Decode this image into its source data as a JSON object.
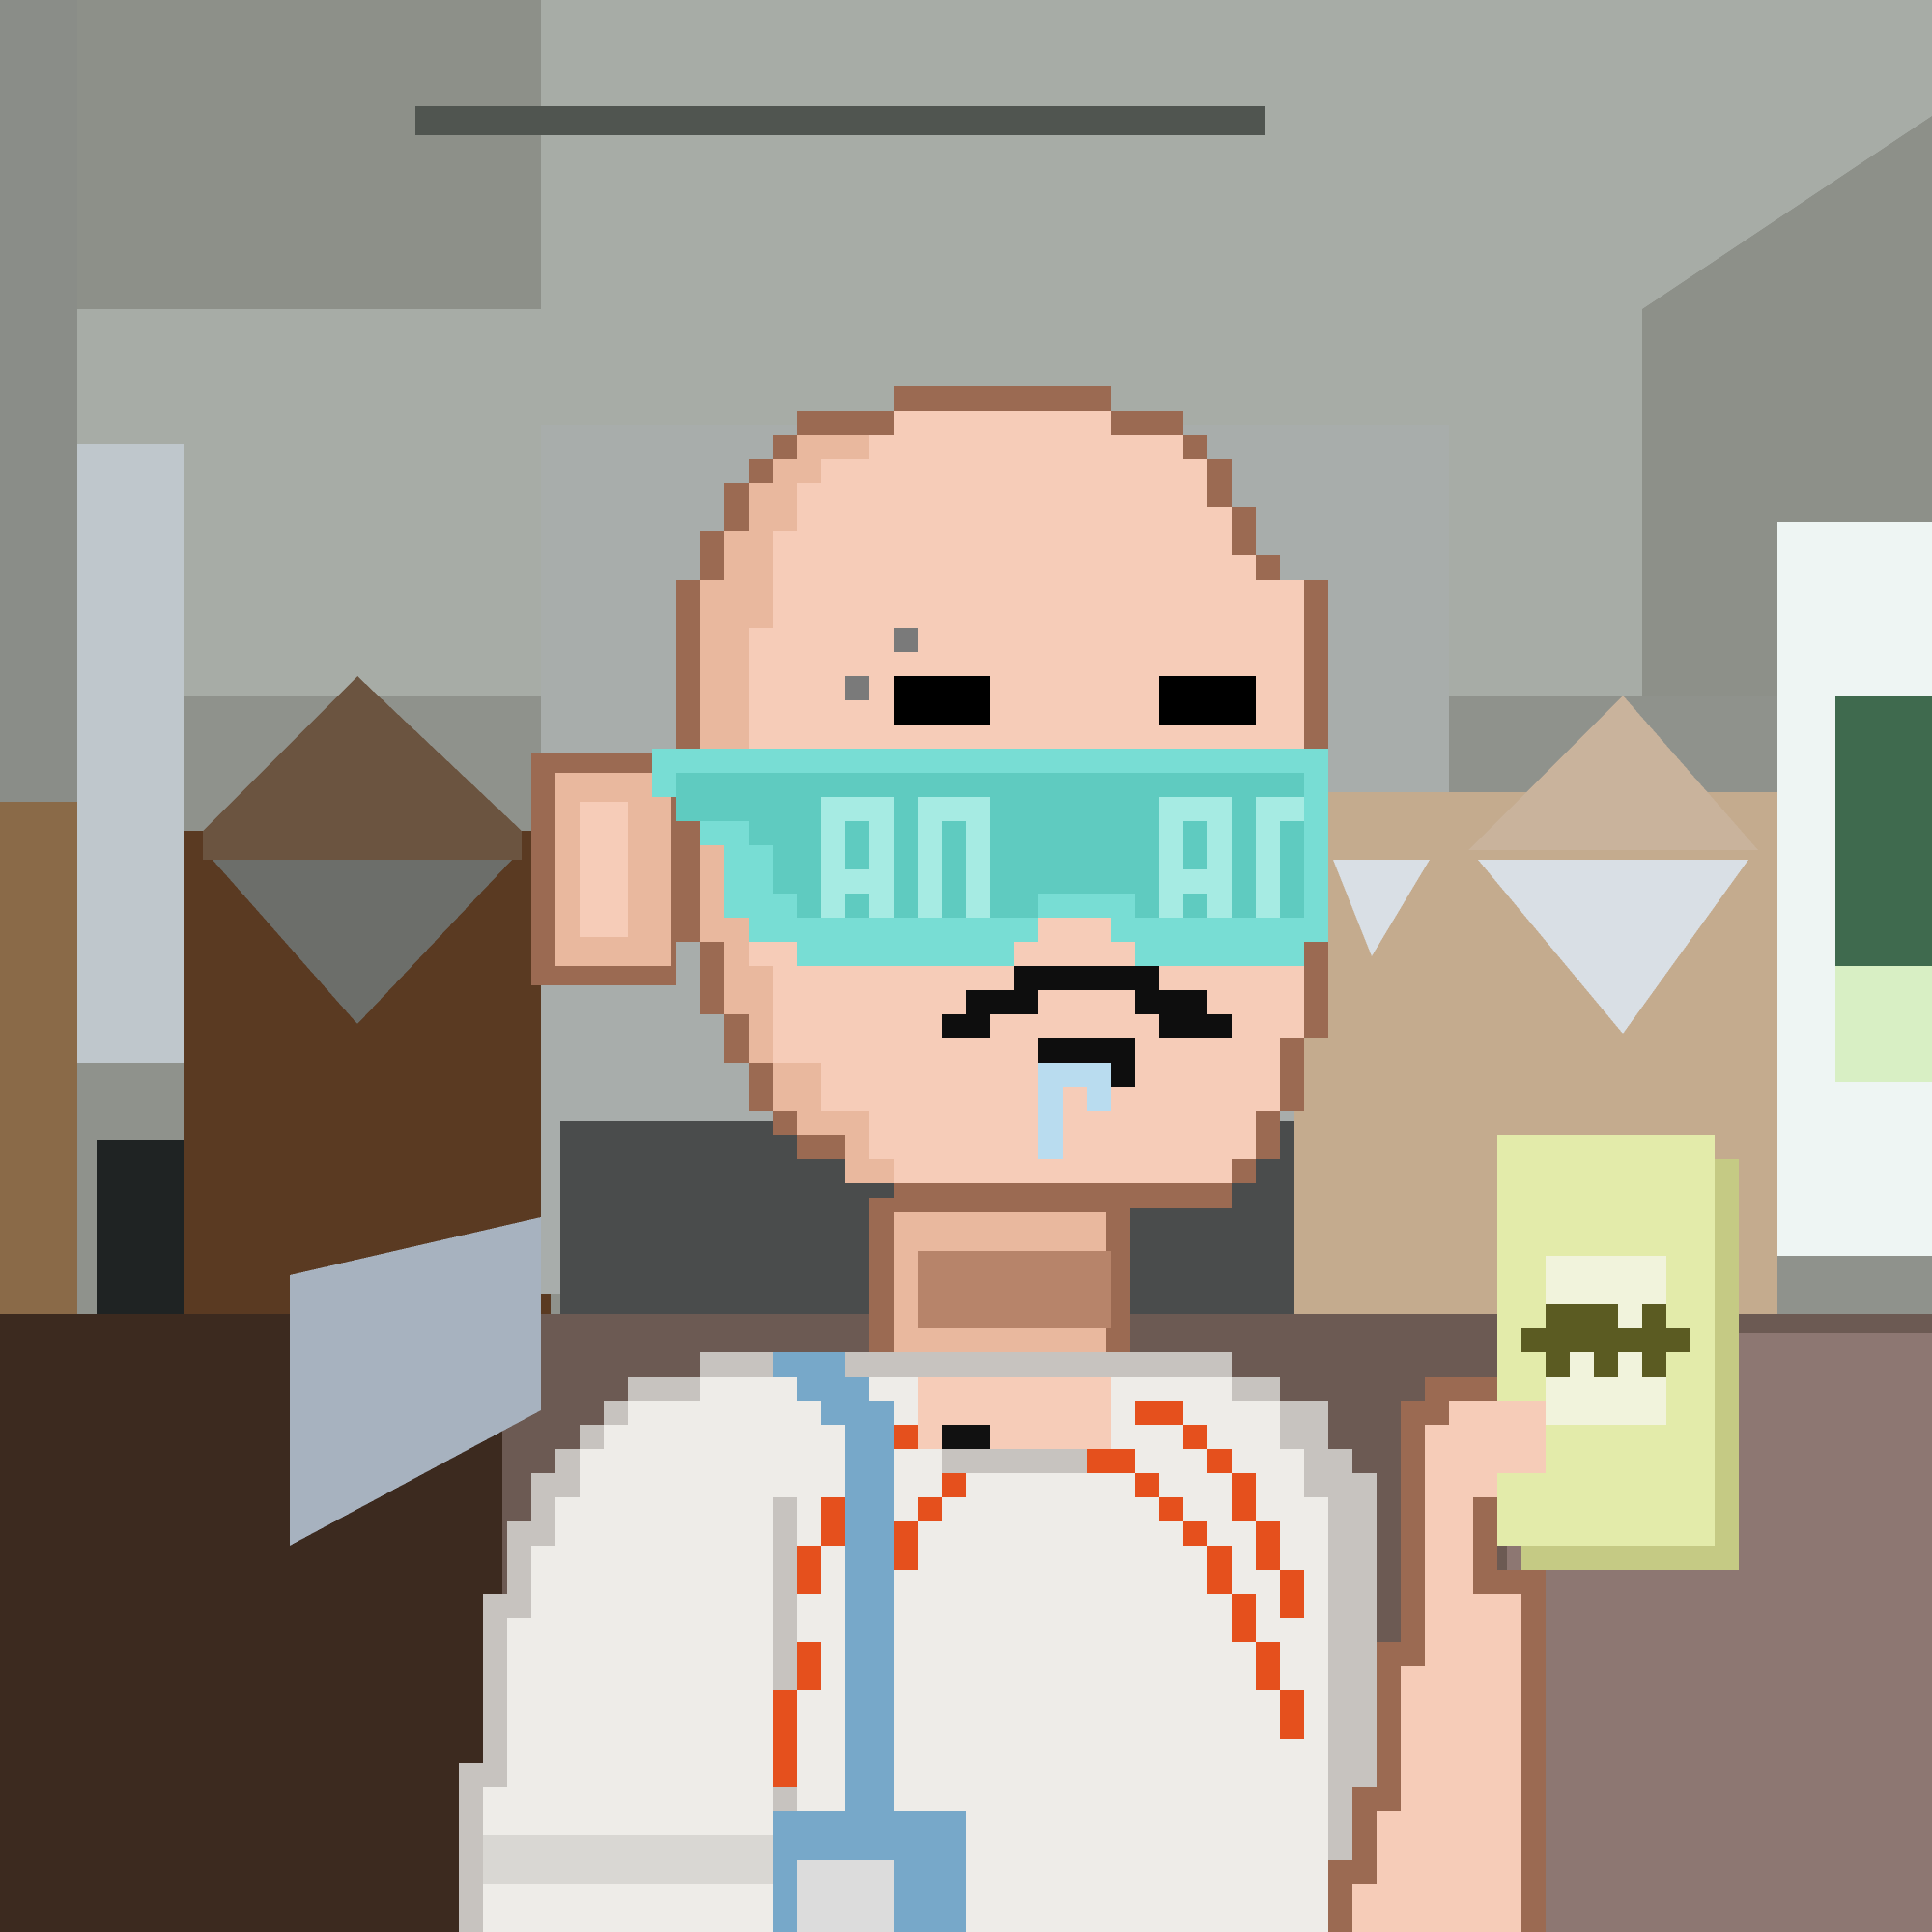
{
  "image": {
    "style": "pixel-art",
    "subject": "bald-character",
    "palette": {
      "ceiling": "#a7aca6",
      "ceiling_shadow": "#8d9089",
      "wall_brown": "#5a3a22",
      "wall_dark": "#3c2a1f",
      "floor": "#6c5a53",
      "skin": "#f6ccb8",
      "skin_shadow": "#e9b89e",
      "skin_outline": "#9b6a52",
      "goggle_frame": "#78ddd4",
      "goggle_lens": "#5fcbc0",
      "goggle_text": "#a6ebe3",
      "mustache": "#0e0e0e",
      "drool": "#b9dcef",
      "shirt": "#eeece8",
      "shirt_shade": "#c7c3bf",
      "strap": "#77a8c9",
      "stitch": "#e5501d",
      "money": "#e3ebaa",
      "money_shade": "#c5ca84",
      "dollar": "#5b5b22"
    },
    "goggle_lettering": {
      "left": "9n",
      "right": "9r"
    },
    "money_symbol": "$"
  }
}
